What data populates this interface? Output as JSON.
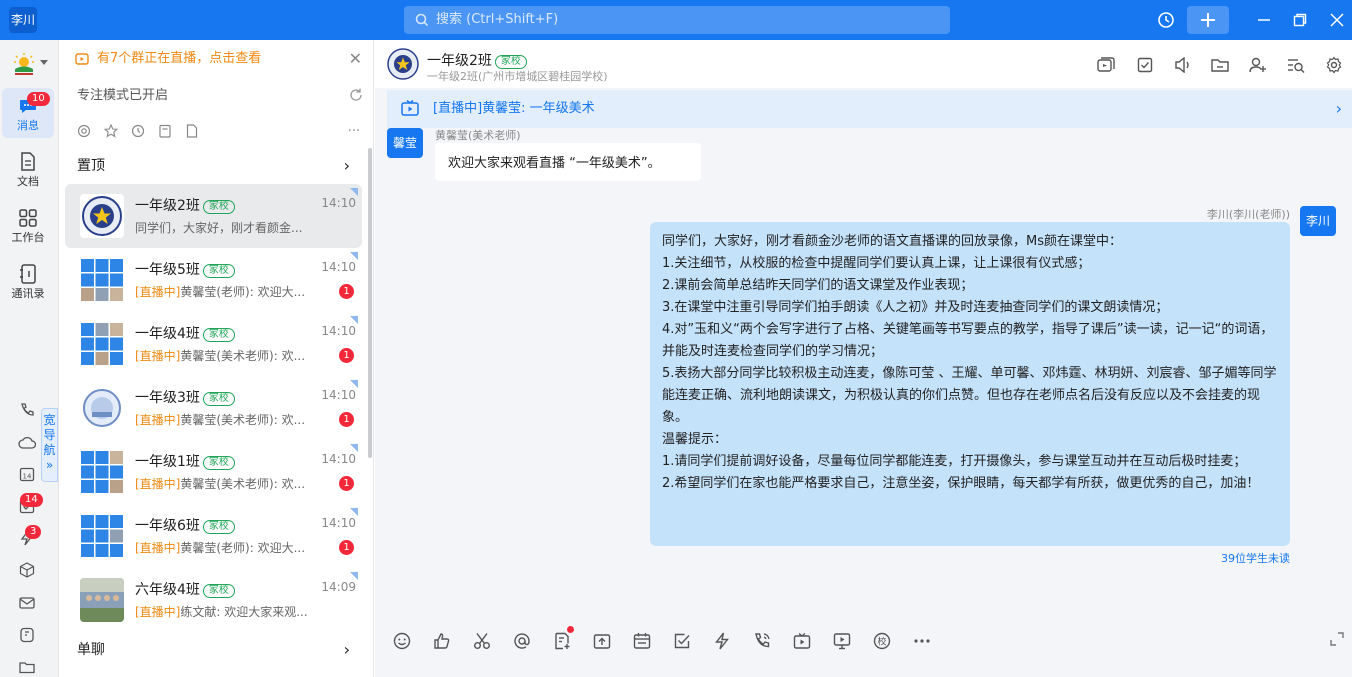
{
  "titlebar": {
    "user_avatar_text": "李川",
    "search_placeholder": "搜索 (Ctrl+Shift+F)"
  },
  "leftnav": {
    "items": [
      {
        "label": "消息",
        "badge": "10",
        "icon": "chat-bubble-icon"
      },
      {
        "label": "文档",
        "icon": "document-icon"
      },
      {
        "label": "工作台",
        "icon": "grid-icon"
      },
      {
        "label": "通讯录",
        "icon": "contacts-icon"
      }
    ],
    "wide_nav_label": "宽导航",
    "extra_badges": [
      "14",
      "3"
    ]
  },
  "convlist": {
    "live_notice": "有7个群正在直播，点击查看",
    "focus_mode": "专注模式已开启",
    "pinned_header": "置顶",
    "single_chat_header": "单聊",
    "conversations": [
      {
        "name": "一年级2班",
        "tag": "家校",
        "time": "14:10",
        "live_prefix": "",
        "preview": "同学们，大家好，刚才看颜金...",
        "unread": ""
      },
      {
        "name": "一年级5班",
        "tag": "家校",
        "time": "14:10",
        "live_prefix": "[直播中]",
        "preview": "黄馨莹(老师): 欢迎大...",
        "unread": "1"
      },
      {
        "name": "一年级4班",
        "tag": "家校",
        "time": "14:10",
        "live_prefix": "[直播中]",
        "preview": "黄馨莹(美术老师): 欢...",
        "unread": "1"
      },
      {
        "name": "一年级3班",
        "tag": "家校",
        "time": "14:10",
        "live_prefix": "[直播中]",
        "preview": "黄馨莹(美术老师): 欢...",
        "unread": "1"
      },
      {
        "name": "一年级1班",
        "tag": "家校",
        "time": "14:10",
        "live_prefix": "[直播中]",
        "preview": "黄馨莹(美术老师): 欢...",
        "unread": "1"
      },
      {
        "name": "一年级6班",
        "tag": "家校",
        "time": "14:10",
        "live_prefix": "[直播中]",
        "preview": "黄馨莹(老师): 欢迎大...",
        "unread": "1"
      },
      {
        "name": "六年级4班",
        "tag": "家校",
        "time": "14:09",
        "live_prefix": "[直播中]",
        "preview": "练文献: 欢迎大家来观...",
        "unread": ""
      }
    ]
  },
  "chat": {
    "title": "一年级2班",
    "tag": "家校",
    "subtitle": "一年级2班(广州市增城区碧桂园学校)",
    "live_bar": "[直播中]黄馨莹: 一年级美术",
    "messages": [
      {
        "avatar": "馨莹",
        "sender": "黄馨莹(美术老师)",
        "text": "欢迎大家来观看直播 “一年级美术”。"
      },
      {
        "avatar": "李川",
        "sender": "李川(李川(老师))",
        "lines": [
          "同学们，大家好，刚才看颜金沙老师的语文直播课的回放录像，Ms颜在课堂中：",
          "1.关注细节，从校服的检查中提醒同学们要认真上课，让上课很有仪式感；",
          "2.课前会简单总结昨天同学们的语文课堂及作业表现；",
          "3.在课堂中注重引导同学们拍手朗读《人之初》并及时连麦抽查同学们的课文朗读情况；",
          "4.对”玉和义“两个会写字进行了占格、关键笔画等书写要点的教学，指导了课后”读一读，记一记“的词语，并能及时连麦检查同学们的学习情况；",
          "5.表扬大部分同学比较积极主动连麦，像陈可莹 、王耀、单可馨、邓炜霆、林玥妍、刘宸睿、邹子媚等同学能连麦正确、流利地朗读课文，为积极认真的你们点赞。但也存在老师点名后没有反应以及不会挂麦的现象。",
          "温馨提示：",
          "1.请同学们提前调好设备，尽量每位同学都能连麦，打开摄像头，参与课堂互动并在互动后极时挂麦；",
          "2.希望同学们在家也能严格要求自己，注意坐姿，保护眼睛，每天都学有所获，做更优秀的自己，加油！"
        ],
        "unread_note": "39位学生未读"
      }
    ]
  },
  "colors": {
    "brand_blue": "#1677f0",
    "live_orange": "#f08a14",
    "badge_red": "#f3283b",
    "tag_green": "#22a559",
    "my_bubble": "#c5e2fb"
  }
}
